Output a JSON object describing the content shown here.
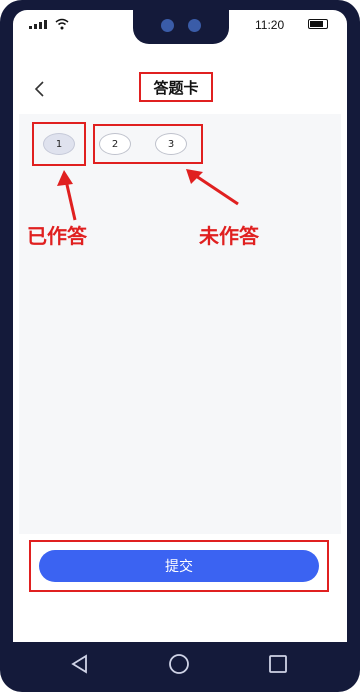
{
  "status_bar": {
    "time": "11:20"
  },
  "header": {
    "title": "答题卡"
  },
  "questions": [
    {
      "number": "1",
      "answered": true
    },
    {
      "number": "2",
      "answered": false
    },
    {
      "number": "3",
      "answered": false
    }
  ],
  "annotations": {
    "answered_label": "已作答",
    "unanswered_label": "未作答"
  },
  "footer": {
    "submit_label": "提交"
  },
  "colors": {
    "accent": "#3b63f2",
    "highlight": "#e02020",
    "frame": "#141a3a"
  },
  "icons": {
    "back": "chevron-left-icon",
    "nav_back": "triangle-back-icon",
    "nav_home": "circle-home-icon",
    "nav_recent": "square-recent-icon"
  }
}
